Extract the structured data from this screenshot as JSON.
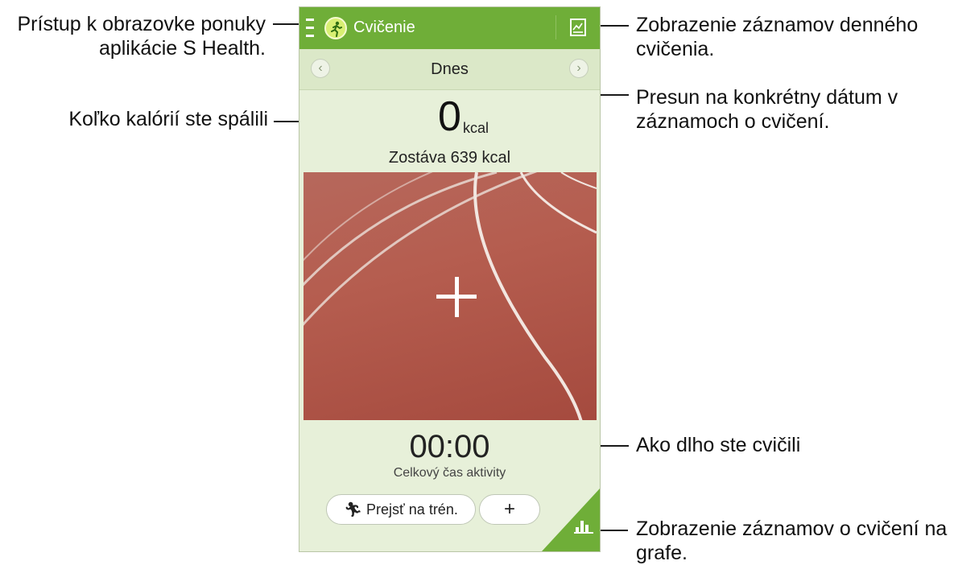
{
  "callouts": {
    "menu": [
      "Prístup k obrazovke ponuky",
      "aplikácie S Health."
    ],
    "calories": "Koľko kalórií ste spálili",
    "daily_records": [
      "Zobrazenie záznamov denného",
      "cvičenia."
    ],
    "date_move": [
      "Presun na konkrétny dátum v",
      "záznamoch o cvičení."
    ],
    "duration": "Ako dlho ste cvičili",
    "graph": [
      "Zobrazenie záznamov o cvičení na",
      "grafe."
    ]
  },
  "app": {
    "title": "Cvičenie",
    "accent_color": "#6fae38",
    "menu_icon": "menu-icon",
    "logo_icon": "runner-icon",
    "records_icon": "chart-records-icon"
  },
  "date_bar": {
    "label": "Dnes",
    "prev": "‹",
    "next": "›"
  },
  "calories": {
    "value": "0",
    "unit": "kcal",
    "remaining": "Zostáva 639 kcal"
  },
  "activity": {
    "duration": "00:00",
    "label": "Celkový čas aktivity"
  },
  "buttons": {
    "workout": "Prejsť na trén.",
    "add": "+"
  }
}
